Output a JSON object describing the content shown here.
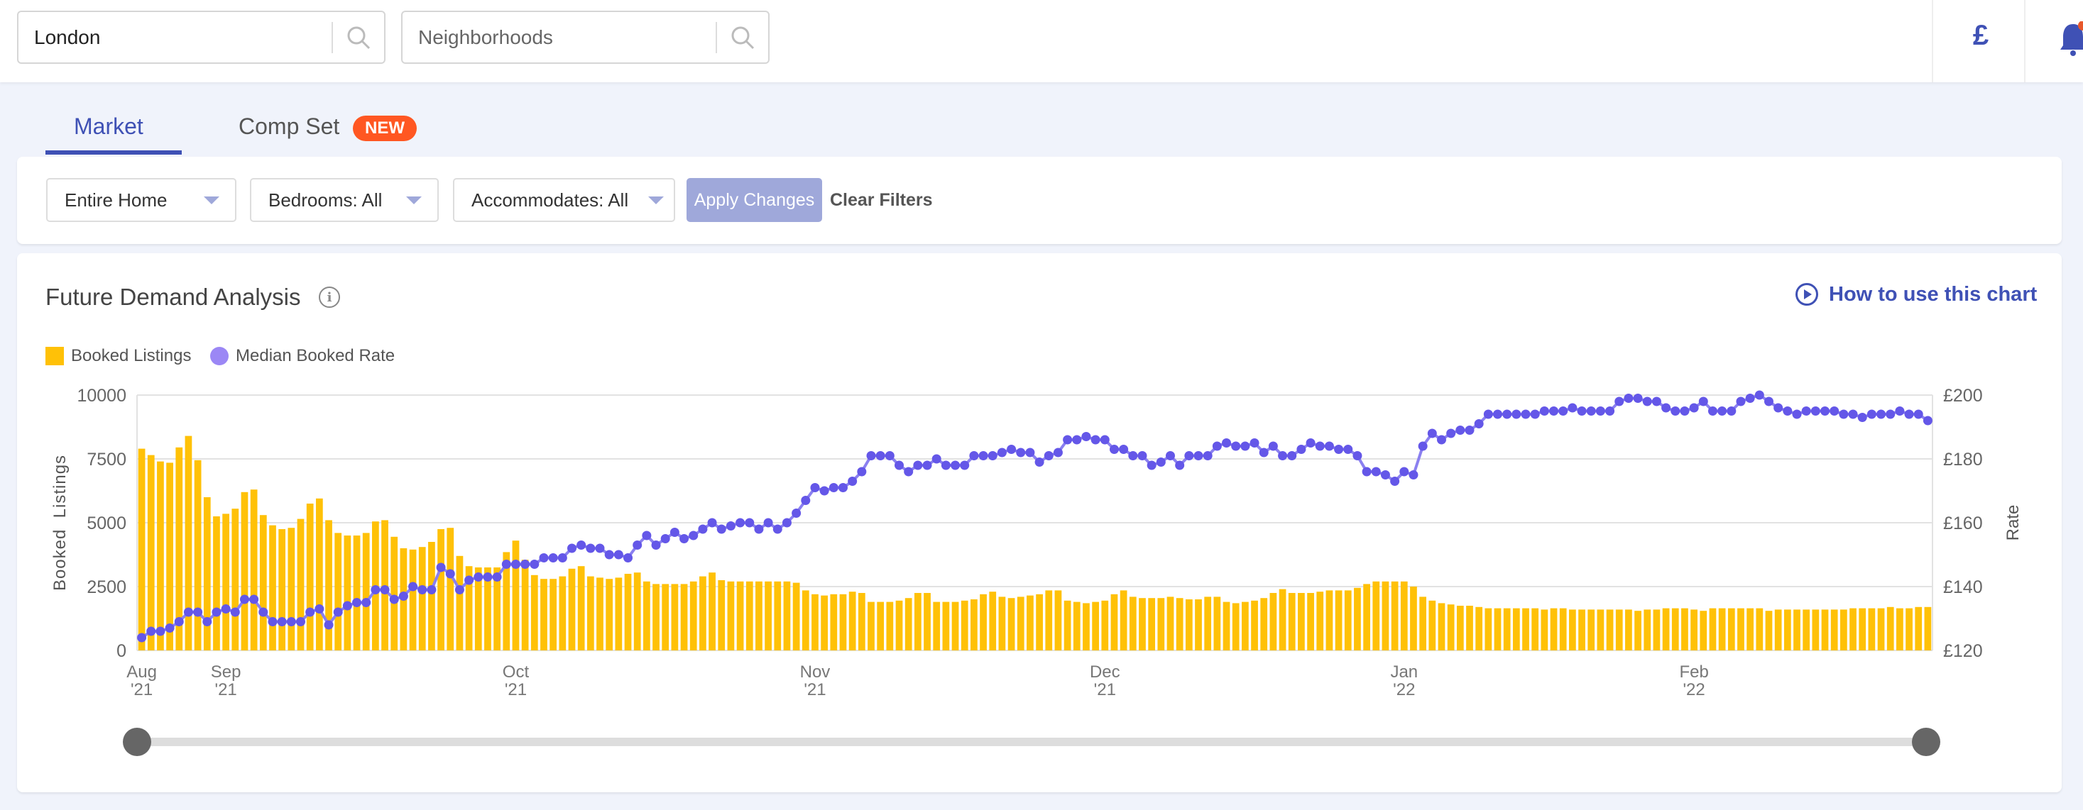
{
  "header": {
    "city_search": {
      "value": "London",
      "placeholder": "",
      "icon": "search-icon"
    },
    "neighborhood_search": {
      "value": "",
      "placeholder": "Neighborhoods",
      "icon": "search-icon"
    },
    "currency_symbol": "£",
    "notification_icon": "bell-icon"
  },
  "tabs": [
    {
      "label": "Market",
      "active": true
    },
    {
      "label": "Comp Set",
      "badge": "NEW"
    }
  ],
  "filters": {
    "property_type": "Entire Home",
    "bedrooms": "Bedrooms: All",
    "accommodates": "Accommodates: All",
    "apply_label": "Apply Changes",
    "clear_label": "Clear Filters"
  },
  "chart_section": {
    "title": "Future Demand Analysis",
    "help_link": "How to use this chart"
  },
  "colors": {
    "accent": "#3f51b5",
    "bars": "#ffc107",
    "line": "#8b80f0",
    "points": "#6457e8",
    "badge": "#ff5722",
    "apply": "#9fa8da"
  },
  "chart_data": {
    "type": "bar+line",
    "legend": [
      {
        "name": "Booked Listings"
      },
      {
        "name": "Median Booked Rate"
      }
    ],
    "legend_placement": "top-left",
    "grid": true,
    "y_left": {
      "label": "Booked  Listings",
      "range": [
        0,
        10000
      ],
      "ticks": [
        "0",
        "2500",
        "5000",
        "7500",
        "10000"
      ],
      "tick_values": [
        0,
        2500,
        5000,
        7500,
        10000
      ]
    },
    "y_right": {
      "label": "Rate",
      "range": [
        120,
        200
      ],
      "ticks": [
        "£120",
        "£140",
        "£160",
        "£180",
        "£200"
      ],
      "tick_values": [
        120,
        140,
        160,
        180,
        200
      ]
    },
    "x_ticks": [
      {
        "month": "Aug",
        "year": "'21",
        "index": 0
      },
      {
        "month": "Sep",
        "year": "'21",
        "index": 9
      },
      {
        "month": "Oct",
        "year": "'21",
        "index": 40
      },
      {
        "month": "Nov",
        "year": "'21",
        "index": 72
      },
      {
        "month": "Dec",
        "year": "'21",
        "index": 103
      },
      {
        "month": "Jan",
        "year": "'22",
        "index": 135
      },
      {
        "month": "Feb",
        "year": "'22",
        "index": 166
      }
    ],
    "series": [
      {
        "name": "Booked Listings",
        "type": "bar",
        "axis": "left",
        "values": [
          7900,
          7650,
          7400,
          7350,
          7950,
          8400,
          7450,
          6000,
          5250,
          5350,
          5550,
          6200,
          6300,
          5300,
          4900,
          4750,
          4800,
          5150,
          5750,
          5950,
          5100,
          4600,
          4500,
          4500,
          4600,
          5050,
          5100,
          4450,
          4000,
          3950,
          4050,
          4250,
          4750,
          4800,
          3700,
          3300,
          3250,
          3250,
          3250,
          3850,
          4300,
          3550,
          2950,
          2800,
          2800,
          2900,
          3200,
          3300,
          2900,
          2850,
          2800,
          2850,
          3000,
          3050,
          2700,
          2600,
          2600,
          2600,
          2600,
          2700,
          2900,
          3050,
          2750,
          2700,
          2700,
          2700,
          2700,
          2700,
          2700,
          2700,
          2650,
          2350,
          2200,
          2150,
          2200,
          2200,
          2300,
          2250,
          1900,
          1900,
          1900,
          1950,
          2050,
          2250,
          2250,
          1900,
          1900,
          1900,
          1950,
          2000,
          2200,
          2300,
          2100,
          2050,
          2100,
          2150,
          2200,
          2350,
          2350,
          1950,
          1900,
          1850,
          1900,
          1950,
          2200,
          2350,
          2100,
          2050,
          2050,
          2050,
          2100,
          2050,
          2000,
          2000,
          2100,
          2100,
          1900,
          1850,
          1900,
          1950,
          2050,
          2250,
          2400,
          2250,
          2250,
          2250,
          2300,
          2350,
          2350,
          2350,
          2450,
          2600,
          2700,
          2700,
          2700,
          2700,
          2500,
          2100,
          1950,
          1850,
          1800,
          1750,
          1750,
          1700,
          1650,
          1650,
          1650,
          1650,
          1650,
          1650,
          1600,
          1650,
          1650,
          1600,
          1600,
          1600,
          1600,
          1600,
          1600,
          1600,
          1550,
          1600,
          1600,
          1650,
          1650,
          1650,
          1600,
          1550,
          1650,
          1650,
          1650,
          1650,
          1650,
          1650,
          1550,
          1600,
          1600,
          1600,
          1600,
          1600,
          1600,
          1600,
          1600,
          1650,
          1650,
          1650,
          1650,
          1700,
          1650,
          1650,
          1700,
          1700
        ]
      },
      {
        "name": "Median Booked Rate",
        "type": "line",
        "axis": "right",
        "values": [
          124,
          126,
          126,
          127,
          129,
          132,
          132,
          129,
          132,
          133,
          132,
          136,
          136,
          132,
          129,
          129,
          129,
          129,
          132,
          133,
          128,
          132,
          134,
          135,
          135,
          139,
          139,
          136,
          137,
          140,
          139,
          139,
          146,
          144,
          139,
          142,
          143,
          143,
          143,
          147,
          147,
          147,
          147,
          149,
          149,
          149,
          152,
          153,
          152,
          152,
          150,
          150,
          149,
          153,
          156,
          153,
          155,
          157,
          155,
          156,
          158,
          160,
          158,
          159,
          160,
          160,
          158,
          160,
          158,
          160,
          163,
          167,
          171,
          170,
          171,
          171,
          173,
          176,
          181,
          181,
          181,
          178,
          176,
          178,
          178,
          180,
          178,
          178,
          178,
          181,
          181,
          181,
          182,
          183,
          182,
          182,
          179,
          181,
          182,
          186,
          186,
          187,
          186,
          186,
          183,
          183,
          181,
          181,
          178,
          179,
          181,
          178,
          181,
          181,
          181,
          184,
          185,
          184,
          184,
          185,
          182,
          184,
          181,
          181,
          183,
          185,
          184,
          184,
          183,
          183,
          181,
          176,
          176,
          175,
          173,
          176,
          175,
          184,
          188,
          186,
          188,
          189,
          189,
          191,
          194,
          194,
          194,
          194,
          194,
          194,
          195,
          195,
          195,
          196,
          195,
          195,
          195,
          195,
          198,
          199,
          199,
          198,
          198,
          196,
          195,
          195,
          196,
          198,
          195,
          195,
          195,
          198,
          199,
          200,
          198,
          196,
          195,
          194,
          195,
          195,
          195,
          195,
          194,
          194,
          193,
          194,
          194,
          194,
          195,
          194,
          194,
          192
        ]
      }
    ],
    "range_slider": {
      "start": 0,
      "end": 1
    }
  }
}
